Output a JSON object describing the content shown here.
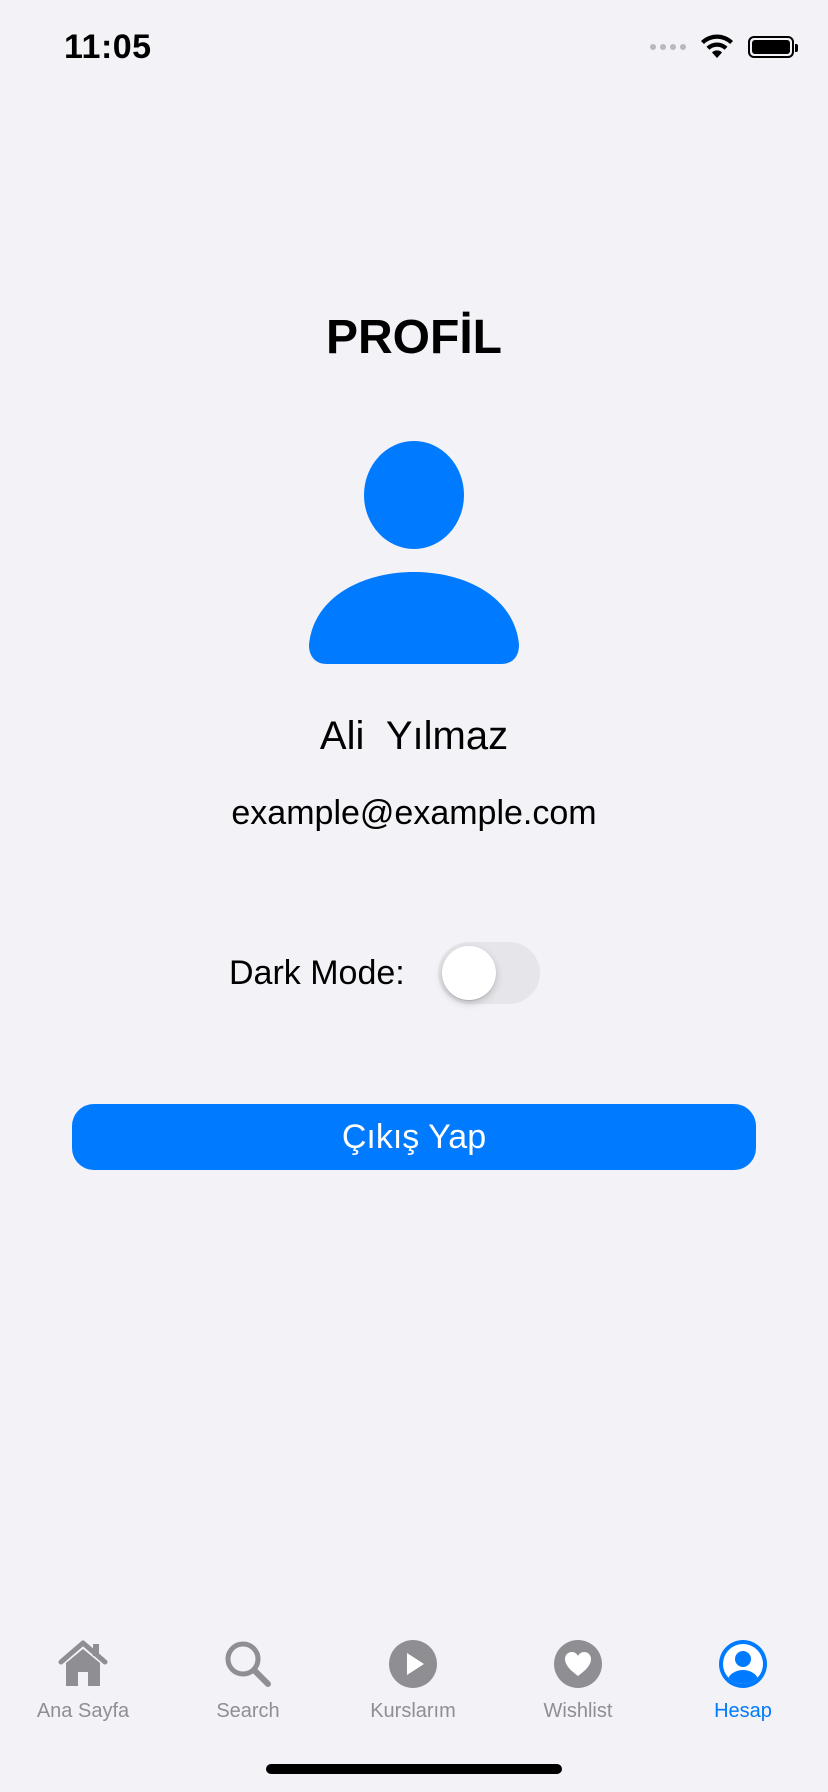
{
  "status_bar": {
    "time": "11:05",
    "icons": [
      "signal-dots-icon",
      "wifi-icon",
      "battery-icon"
    ]
  },
  "profile": {
    "title": "PROFİL",
    "avatar_icon": "person-icon",
    "name": "Ali  Yılmaz",
    "email": "example@example.com",
    "dark_mode_label": "Dark Mode:",
    "dark_mode_on": false,
    "logout_label": "Çıkış Yap"
  },
  "tab_bar": {
    "items": [
      {
        "label": "Ana Sayfa",
        "icon": "house-icon",
        "active": false
      },
      {
        "label": "Search",
        "icon": "magnifying-glass-icon",
        "active": false
      },
      {
        "label": "Kurslarım",
        "icon": "play-circle-icon",
        "active": false
      },
      {
        "label": "Wishlist",
        "icon": "heart-circle-icon",
        "active": false
      },
      {
        "label": "Hesap",
        "icon": "person-circle-icon",
        "active": true
      }
    ]
  },
  "colors": {
    "accent": "#007aff",
    "background": "#f2f2f7",
    "inactive_tab": "#8e8e93",
    "toggle_off": "#e5e5ea"
  }
}
